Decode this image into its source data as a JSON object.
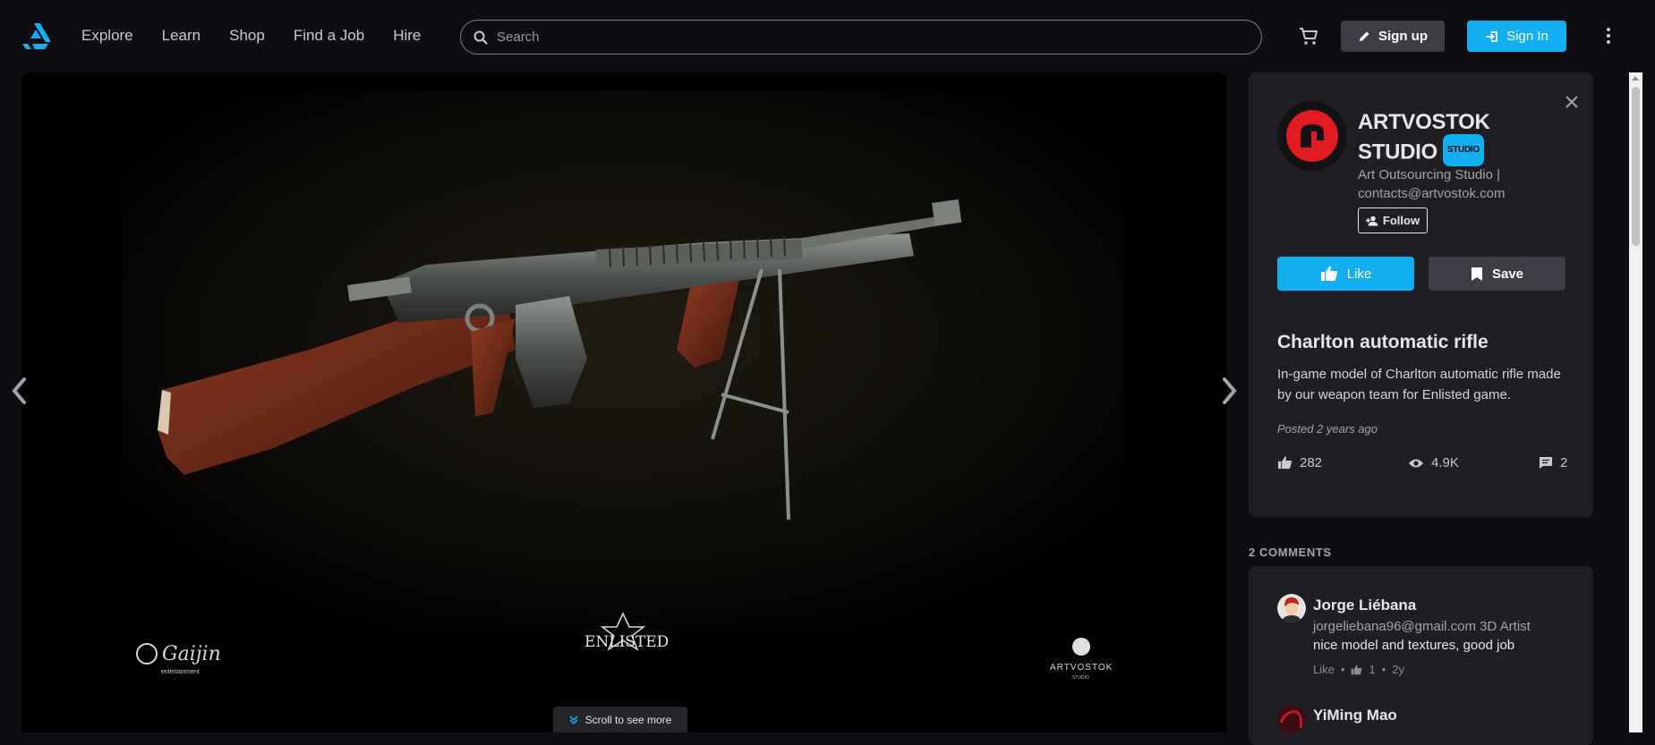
{
  "nav": {
    "items": [
      {
        "label": "Explore"
      },
      {
        "label": "Learn"
      },
      {
        "label": "Shop"
      },
      {
        "label": "Find a Job"
      },
      {
        "label": "Hire"
      }
    ]
  },
  "search": {
    "placeholder": "Search"
  },
  "header": {
    "signup_label": "Sign up",
    "signin_label": "Sign In"
  },
  "viewer": {
    "scroll_label": "Scroll to see more",
    "watermarks": {
      "left": "Gaijin",
      "left_sub": "entertainment",
      "center": "ENLISTED",
      "right": "ARTVOSTOK",
      "right_sub": "STUDIO"
    }
  },
  "artist": {
    "name": "ARTVOSTOK STUDIO",
    "badge": "STUDIO",
    "tagline": "Art Outsourcing Studio | contacts@artvostok.com",
    "follow_label": "Follow"
  },
  "actions": {
    "like_label": "Like",
    "save_label": "Save"
  },
  "artwork": {
    "title": "Charlton automatic rifle",
    "description": "In-game model of Charlton automatic rifle made by our weapon team for Enlisted game.",
    "posted": "Posted 2 years ago",
    "likes": "282",
    "views": "4.9K",
    "comments": "2"
  },
  "comments": {
    "heading": "2 COMMENTS",
    "items": [
      {
        "name": "Jorge Liébana",
        "headline": "jorgeliebana96@gmail.com 3D Artist",
        "text": "nice model and textures, good job",
        "like_label": "Like",
        "likes": "1",
        "age": "2y"
      },
      {
        "name": "YiMing Mao"
      }
    ]
  },
  "colors": {
    "accent": "#13aff0",
    "background": "#0e0e12",
    "panel": "#1e1e24"
  }
}
